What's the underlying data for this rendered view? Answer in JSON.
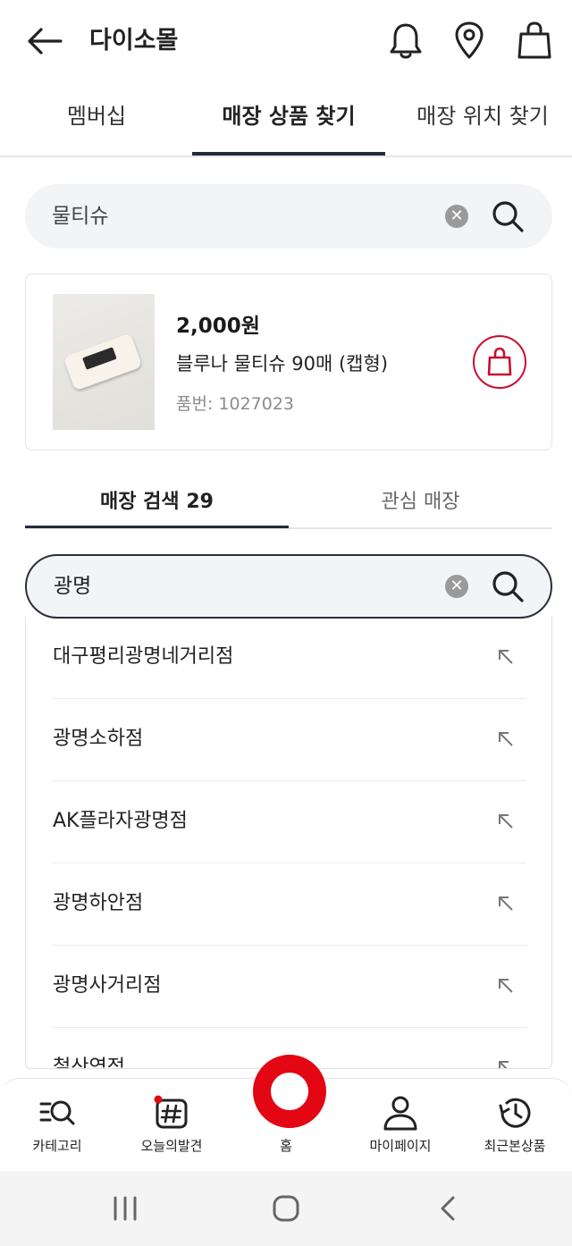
{
  "header": {
    "title": "다이소몰",
    "icons": [
      "back-arrow-icon",
      "bell-icon",
      "location-pin-icon",
      "shopping-bag-icon"
    ]
  },
  "tabs": [
    {
      "label": "멤버십"
    },
    {
      "label": "매장 상품 찾기",
      "active": true
    },
    {
      "label": "매장 위치 찾기"
    }
  ],
  "product_search": {
    "value": "물티슈"
  },
  "product": {
    "price": "2,000원",
    "name": "블루나 물티슈 90매 (캡형)",
    "code": "품번: 1027023"
  },
  "store_tabs": [
    {
      "label": "매장 검색 29",
      "active": true
    },
    {
      "label": "관심 매장"
    }
  ],
  "store_search": {
    "value": "광명"
  },
  "suggestions": [
    "대구평리광명네거리점",
    "광명소하점",
    "AK플라자광명점",
    "광명하안점",
    "광명사거리점",
    "철산역점"
  ],
  "bottom_nav": [
    {
      "label": "카테고리",
      "icon": "category-search-icon"
    },
    {
      "label": "오늘의발견",
      "icon": "hashtag-icon"
    },
    {
      "label": "홈",
      "icon": "home-ring-icon"
    },
    {
      "label": "마이페이지",
      "icon": "person-icon"
    },
    {
      "label": "최근본상품",
      "icon": "history-icon"
    }
  ],
  "colors": {
    "brand_red": "#e30613",
    "accent_dark": "#222a3a"
  }
}
